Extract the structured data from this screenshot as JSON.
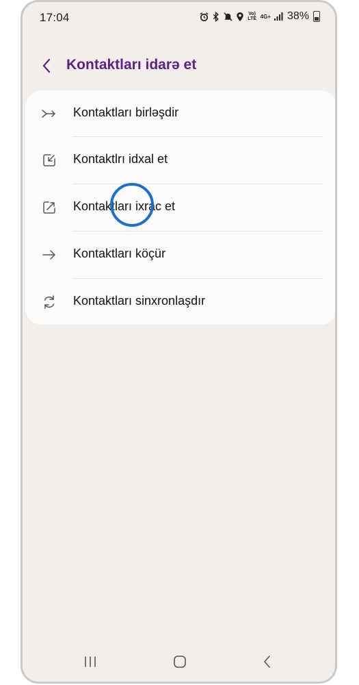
{
  "status_bar": {
    "time": "17:04",
    "battery_percent": "38%",
    "network_label": "4G+",
    "volte_label": "Vo) LTE",
    "icons": [
      "alarm-icon",
      "bluetooth-icon",
      "mute-icon",
      "location-icon",
      "volte-icon",
      "network-4g-icon",
      "signal-icon",
      "battery-icon"
    ]
  },
  "header": {
    "title": "Kontaktları idarə et",
    "back_icon": "back-chevron-icon"
  },
  "menu": {
    "items": [
      {
        "label": "Kontaktları birləşdir",
        "icon": "merge-icon"
      },
      {
        "label": "Kontaktlrı idxal et",
        "icon": "import-icon"
      },
      {
        "label": "Kontaktları ixrac et",
        "icon": "export-icon"
      },
      {
        "label": "Kontaktları köçür",
        "icon": "arrow-right-icon"
      },
      {
        "label": "Kontaktları sinxronlaşdır",
        "icon": "sync-icon"
      }
    ]
  },
  "nav_bar": {
    "buttons": [
      "recents-icon",
      "home-icon",
      "back-icon"
    ]
  },
  "colors": {
    "background": "#f3eeea",
    "card": "#fcfbfb",
    "title": "#5a1f8c",
    "tap_indicator": "#1a6fd0"
  }
}
